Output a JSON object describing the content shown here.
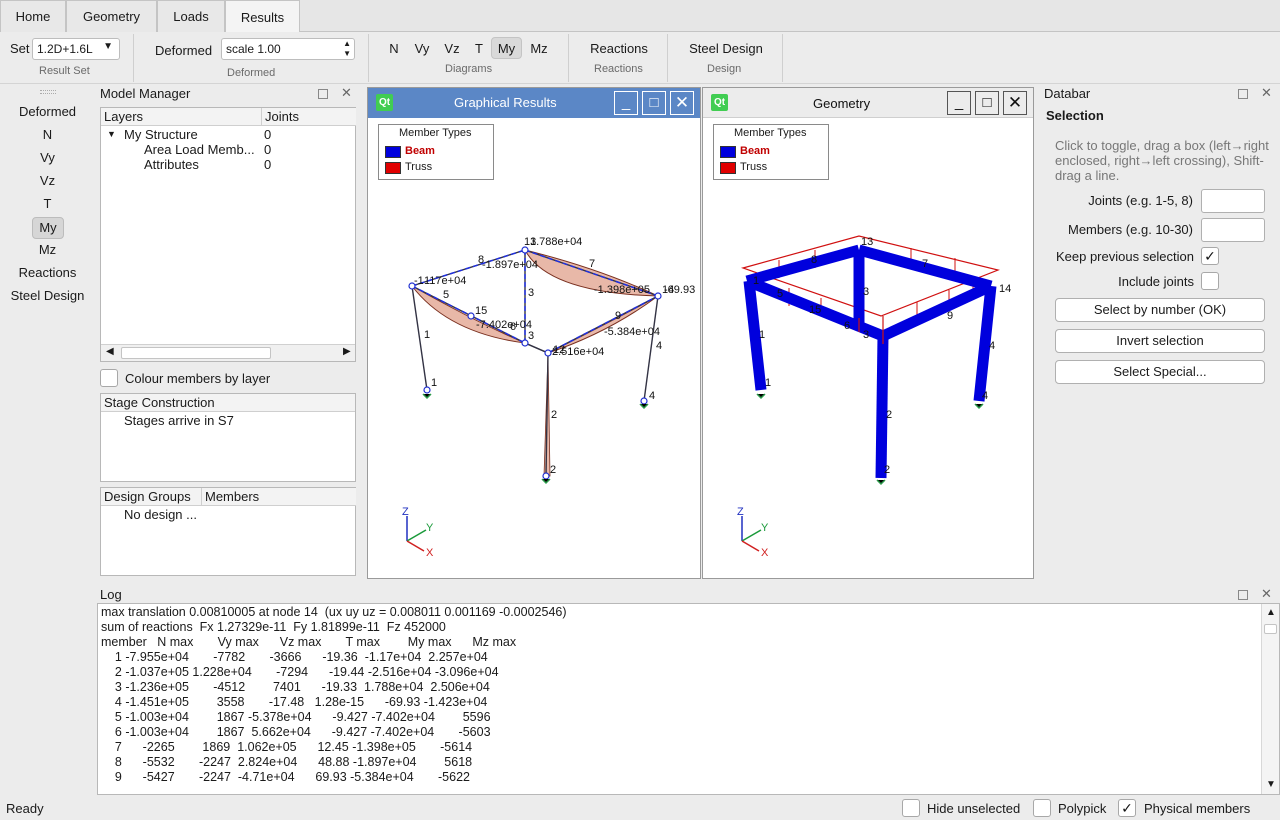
{
  "tabs": [
    {
      "label": "Home"
    },
    {
      "label": "Geometry"
    },
    {
      "label": "Loads"
    },
    {
      "label": "Results"
    }
  ],
  "ribbon": {
    "set_label": "Set",
    "set_value": "1.2D+1.6L",
    "result_set_label": "Result Set",
    "deformed_label": "Deformed",
    "deformed_value": "scale 1.00",
    "deformed_group": "Deformed",
    "diagrams": [
      "N",
      "Vy",
      "Vz",
      "T",
      "My",
      "Mz"
    ],
    "diagrams_selected": "My",
    "diagrams_group": "Diagrams",
    "reactions_label": "Reactions",
    "reactions_group": "Reactions",
    "steel_label": "Steel Design",
    "steel_group": "Design"
  },
  "left_buttons": [
    "Deformed",
    "N",
    "Vy",
    "Vz",
    "T",
    "My",
    "Mz",
    "Reactions",
    "Steel Design"
  ],
  "left_selected": "My",
  "model_manager": {
    "title": "Model Manager",
    "col_layers": "Layers",
    "col_joints": "Joints",
    "rows": [
      {
        "name": "My Structure",
        "joints": "0"
      },
      {
        "name": "Area Load Memb...",
        "joints": "0"
      },
      {
        "name": "Attributes",
        "joints": "0"
      }
    ],
    "colour_by_layer": "Colour members by layer",
    "stage_title": "Stage Construction",
    "stage_text": "Stages arrive in S7",
    "design_col1": "Design Groups",
    "design_col2": "Members",
    "design_text": "No design ..."
  },
  "graphical": {
    "title": "Graphical Results",
    "legend_title": "Member Types",
    "legend_beam": "Beam",
    "legend_truss": "Truss",
    "labels": {
      "m13": "13",
      "v13": "1.788e+04",
      "m8": "8",
      "v8": "-1.897e+04",
      "m7": "7",
      "m11": "-1",
      "v11": "117e+04",
      "v7": "-1.398e+05",
      "m14": "14",
      "v14": "-69.93",
      "m5": "5",
      "m3a": "3",
      "m15": "15",
      "m9": "9",
      "v15": "-7.402e+04",
      "m6": "6",
      "m3b": "3",
      "v9": "-5.384e+04",
      "m1": "1",
      "m12": "12",
      "v12": "2.516e+04",
      "m4": "4",
      "n1": "1",
      "n4": "4",
      "m2": "2",
      "n2": "2"
    },
    "axis_z": "Z",
    "axis_y": "Y",
    "axis_x": "X"
  },
  "geometry": {
    "title": "Geometry",
    "legend_title": "Member Types",
    "legend_beam": "Beam",
    "legend_truss": "Truss",
    "labels": {
      "m13": "13",
      "m8": "8",
      "m7": "7",
      "m11": "1",
      "m14": "14",
      "m5": "5",
      "m3a": "3",
      "m15": "15",
      "m6": "6",
      "m3b": "3",
      "m9": "9",
      "m1": "1",
      "m4": "4",
      "m2": "2",
      "n1": "1",
      "n4": "4",
      "n2": "2"
    },
    "axis_z": "Z",
    "axis_y": "Y",
    "axis_x": "X"
  },
  "databar": {
    "title": "Databar",
    "section": "Selection",
    "hint": "Click to toggle, drag a box (left→right enclosed, right→left crossing), Shift-drag a line.",
    "joints_label": "Joints (e.g. 1-5, 8)",
    "members_label": "Members (e.g. 10-30)",
    "keep_label": "Keep previous selection",
    "keep_checked": "✓",
    "include_label": "Include joints",
    "btn_select_number": "Select by number (OK)",
    "btn_invert": "Invert selection",
    "btn_special": "Select Special..."
  },
  "log": {
    "title": "Log",
    "lines": [
      "max translation 0.00810005 at node 14  (ux uy uz = 0.008011 0.001169 -0.0002546)",
      "sum of reactions  Fx 1.27329e-11  Fy 1.81899e-11  Fz 452000",
      "member   N max       Vy max      Vz max       T max        My max      Mz max",
      "    1 -7.955e+04       -7782       -3666      -19.36  -1.17e+04  2.257e+04",
      "    2 -1.037e+05 1.228e+04       -7294      -19.44 -2.516e+04 -3.096e+04",
      "    3 -1.236e+05       -4512        7401      -19.33  1.788e+04  2.506e+04",
      "    4 -1.451e+05        3558       -17.48   1.28e-15      -69.93 -1.423e+04",
      "    5 -1.003e+04        1867 -5.378e+04      -9.427 -7.402e+04        5596",
      "    6 -1.003e+04        1867  5.662e+04      -9.427 -7.402e+04       -5603",
      "    7      -2265        1869  1.062e+05      12.45 -1.398e+05       -5614",
      "    8      -5532       -2247  2.824e+04      48.88 -1.897e+04        5618",
      "    9      -5427       -2247  -4.71e+04      69.93 -5.384e+04       -5622"
    ]
  },
  "status": {
    "text": "Ready",
    "hide_unselected": "Hide unselected",
    "polypick": "Polypick",
    "physical": "Physical members",
    "physical_checked": "✓"
  },
  "colors": {
    "beam": "#0000dd",
    "truss": "#e00000",
    "diagram_fill": "#e8b8a8",
    "qt_green": "#41cd52"
  }
}
